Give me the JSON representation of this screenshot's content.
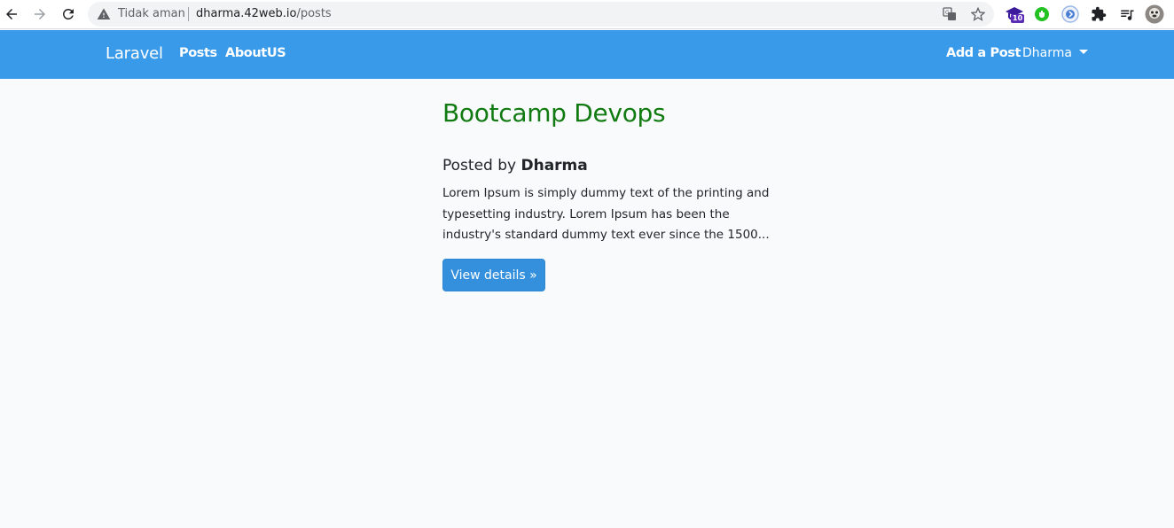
{
  "browser": {
    "security_label": "Tidak aman",
    "url_host": "dharma.42web.io",
    "url_path": "/posts",
    "extension_badge": "10"
  },
  "navbar": {
    "brand": "Laravel",
    "links": [
      "Posts",
      "AboutUS"
    ],
    "add_post": "Add a Post",
    "user": "Dharma"
  },
  "post": {
    "title": "Bootcamp Devops",
    "posted_by_prefix": "Posted by",
    "author": "Dharma",
    "excerpt_lines": [
      "Lorem Ipsum is simply dummy text of the printing and",
      "typesetting industry. Lorem Ipsum has been the",
      "industry's standard dummy text ever since the 1500..."
    ],
    "button_label": "View details »"
  },
  "colors": {
    "navbar": "#3a9aea",
    "title": "#117a11",
    "button": "#3490dc",
    "page_bg": "#f8fafc"
  }
}
